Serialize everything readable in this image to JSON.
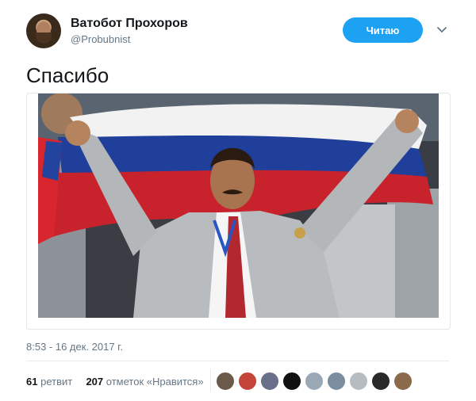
{
  "author": {
    "name": "Ватобот Прохоров",
    "handle": "@Probubnist"
  },
  "follow_button": {
    "label": "Читаю"
  },
  "tweet": {
    "text": "Спасибо",
    "timestamp": "8:53 - 16 дек. 2017 г."
  },
  "stats": {
    "retweets_count": "61",
    "retweets_label": "ретвит",
    "likes_count": "207",
    "likes_label": "отметок «Нравится»"
  },
  "likers": [
    {
      "color": "#6b5a4a"
    },
    {
      "color": "#c4453a"
    },
    {
      "color": "#6a6f8a"
    },
    {
      "color": "#111111"
    },
    {
      "color": "#9aa8b6"
    },
    {
      "color": "#7a8ea0"
    },
    {
      "color": "#b7bcc2"
    },
    {
      "color": "#2a2a2a"
    },
    {
      "color": "#8a6a4a"
    }
  ],
  "colors": {
    "accent": "#1da1f2",
    "flag_white": "#f2f2f2",
    "flag_blue": "#1f3f9a",
    "flag_red": "#c8232c",
    "suit": "#b9bcbf"
  }
}
